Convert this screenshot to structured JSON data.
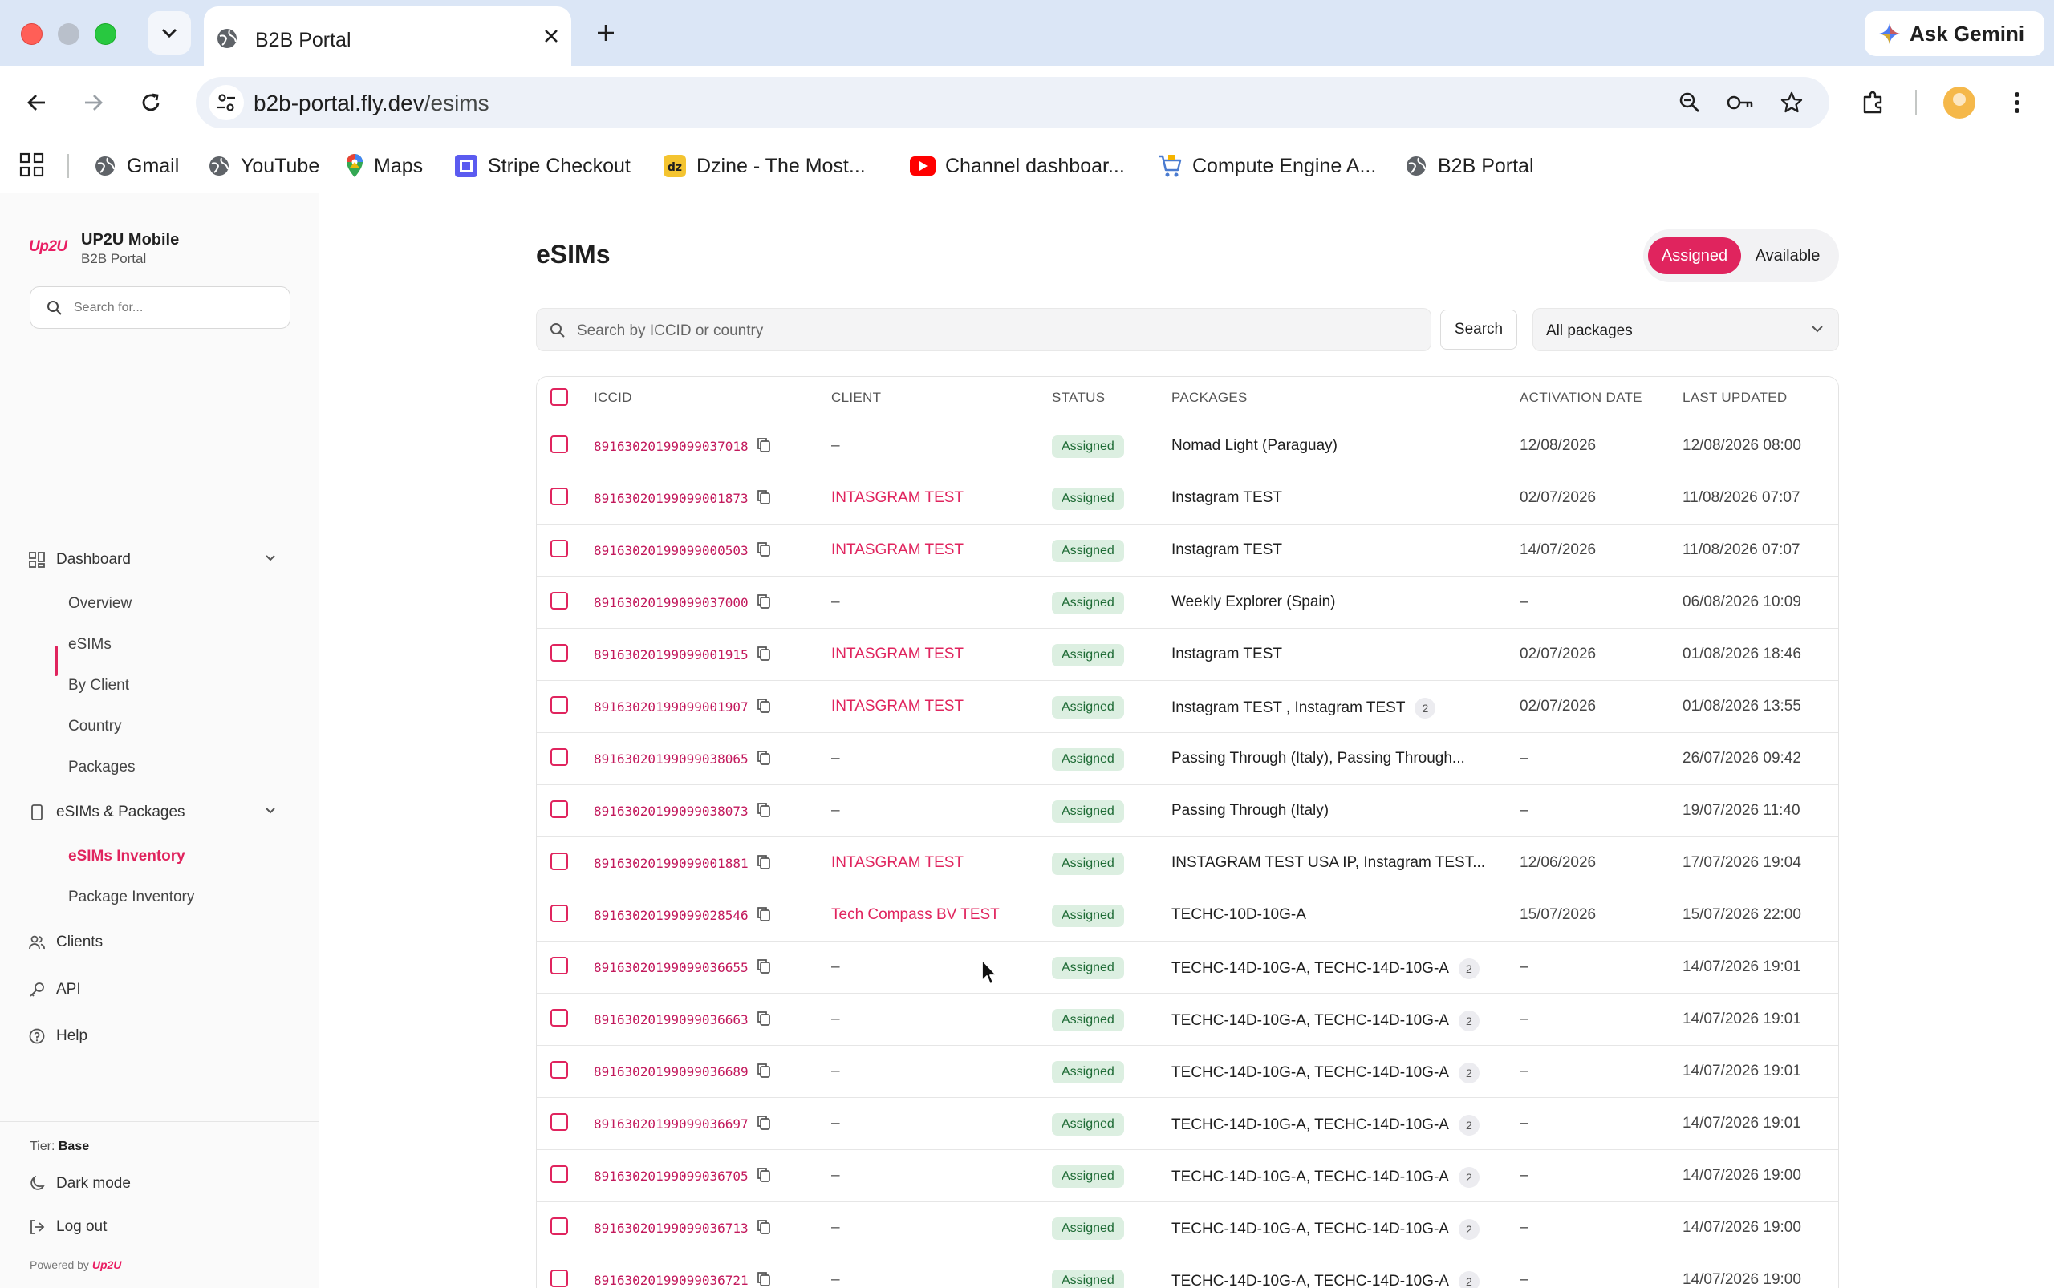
{
  "browser": {
    "tab_title": "B2B Portal",
    "url_host": "b2b-portal.fly.dev",
    "url_path": "/esims",
    "gemini_label": "Ask Gemini",
    "bookmarks": [
      {
        "label": "Gmail",
        "icon": "globe-icon"
      },
      {
        "label": "YouTube",
        "icon": "globe-icon"
      },
      {
        "label": "Maps",
        "icon": "maps-pin-icon"
      },
      {
        "label": "Stripe Checkout",
        "icon": "stripe-icon"
      },
      {
        "label": "Dzine - The Most...",
        "icon": "dzine-icon"
      },
      {
        "label": "Channel dashboar...",
        "icon": "youtube-icon"
      },
      {
        "label": "Compute Engine A...",
        "icon": "cart-icon"
      },
      {
        "label": "B2B Portal",
        "icon": "globe-icon"
      }
    ]
  },
  "sidebar": {
    "logo_text": "Up2U",
    "brand_name": "UP2U Mobile",
    "brand_sub": "B2B Portal",
    "search_placeholder": "Search for...",
    "groups": [
      {
        "label": "Dashboard",
        "icon": "grid-icon"
      },
      {
        "label": "eSIMs & Packages",
        "icon": "phone-icon"
      }
    ],
    "dashboard_items": [
      "Overview",
      "eSIMs",
      "By Client",
      "Country",
      "Packages"
    ],
    "esim_items": [
      "eSIMs Inventory",
      "Package Inventory"
    ],
    "bottom_items": [
      {
        "label": "Clients",
        "icon": "users-icon"
      },
      {
        "label": "API",
        "icon": "key-icon"
      },
      {
        "label": "Help",
        "icon": "help-icon"
      }
    ],
    "tier_label": "Tier:",
    "tier_value": "Base",
    "dark_mode": "Dark mode",
    "log_out": "Log out",
    "powered_by": "Powered by",
    "powered_brand": "Up2U"
  },
  "main": {
    "title": "eSIMs",
    "toggle": {
      "assigned": "Assigned",
      "available": "Available",
      "selected": "Assigned"
    },
    "search_placeholder": "Search by ICCID or country",
    "search_button": "Search",
    "package_filter": "All packages",
    "columns": [
      "ICCID",
      "CLIENT",
      "STATUS",
      "PACKAGES",
      "ACTIVATION DATE",
      "LAST UPDATED"
    ],
    "rows": [
      {
        "iccid": "89163020199099037018",
        "client": "–",
        "status": "Assigned",
        "packages": "Nomad Light (Paraguay)",
        "more": "",
        "activation": "12/08/2026",
        "updated": "12/08/2026 08:00"
      },
      {
        "iccid": "89163020199099001873",
        "client": "INTASGRAM TEST",
        "status": "Assigned",
        "packages": "Instagram TEST",
        "more": "",
        "activation": "02/07/2026",
        "updated": "11/08/2026 07:07"
      },
      {
        "iccid": "89163020199099000503",
        "client": "INTASGRAM TEST",
        "status": "Assigned",
        "packages": "Instagram TEST",
        "more": "",
        "activation": "14/07/2026",
        "updated": "11/08/2026 07:07"
      },
      {
        "iccid": "89163020199099037000",
        "client": "–",
        "status": "Assigned",
        "packages": "Weekly Explorer (Spain)",
        "more": "",
        "activation": "–",
        "updated": "06/08/2026 10:09"
      },
      {
        "iccid": "89163020199099001915",
        "client": "INTASGRAM TEST",
        "status": "Assigned",
        "packages": "Instagram TEST",
        "more": "",
        "activation": "02/07/2026",
        "updated": "01/08/2026 18:46"
      },
      {
        "iccid": "89163020199099001907",
        "client": "INTASGRAM TEST",
        "status": "Assigned",
        "packages": "Instagram TEST , Instagram TEST",
        "more": "2",
        "activation": "02/07/2026",
        "updated": "01/08/2026 13:55"
      },
      {
        "iccid": "89163020199099038065",
        "client": "–",
        "status": "Assigned",
        "packages": "Passing Through (Italy), Passing Through...",
        "more": "",
        "activation": "–",
        "updated": "26/07/2026 09:42"
      },
      {
        "iccid": "89163020199099038073",
        "client": "–",
        "status": "Assigned",
        "packages": "Passing Through (Italy)",
        "more": "",
        "activation": "–",
        "updated": "19/07/2026 11:40"
      },
      {
        "iccid": "89163020199099001881",
        "client": "INTASGRAM TEST",
        "status": "Assigned",
        "packages": "INSTAGRAM TEST USA IP, Instagram TEST...",
        "more": "",
        "activation": "12/06/2026",
        "updated": "17/07/2026 19:04"
      },
      {
        "iccid": "89163020199099028546",
        "client": "Tech Compass BV TEST",
        "status": "Assigned",
        "packages": "TECHC-10D-10G-A",
        "more": "",
        "activation": "15/07/2026",
        "updated": "15/07/2026 22:00"
      },
      {
        "iccid": "89163020199099036655",
        "client": "–",
        "status": "Assigned",
        "packages": "TECHC-14D-10G-A, TECHC-14D-10G-A",
        "more": "2",
        "activation": "–",
        "updated": "14/07/2026 19:01"
      },
      {
        "iccid": "89163020199099036663",
        "client": "–",
        "status": "Assigned",
        "packages": "TECHC-14D-10G-A, TECHC-14D-10G-A",
        "more": "2",
        "activation": "–",
        "updated": "14/07/2026 19:01"
      },
      {
        "iccid": "89163020199099036689",
        "client": "–",
        "status": "Assigned",
        "packages": "TECHC-14D-10G-A, TECHC-14D-10G-A",
        "more": "2",
        "activation": "–",
        "updated": "14/07/2026 19:01"
      },
      {
        "iccid": "89163020199099036697",
        "client": "–",
        "status": "Assigned",
        "packages": "TECHC-14D-10G-A, TECHC-14D-10G-A",
        "more": "2",
        "activation": "–",
        "updated": "14/07/2026 19:01"
      },
      {
        "iccid": "89163020199099036705",
        "client": "–",
        "status": "Assigned",
        "packages": "TECHC-14D-10G-A, TECHC-14D-10G-A",
        "more": "2",
        "activation": "–",
        "updated": "14/07/2026 19:00"
      },
      {
        "iccid": "89163020199099036713",
        "client": "–",
        "status": "Assigned",
        "packages": "TECHC-14D-10G-A, TECHC-14D-10G-A",
        "more": "2",
        "activation": "–",
        "updated": "14/07/2026 19:00"
      },
      {
        "iccid": "89163020199099036721",
        "client": "–",
        "status": "Assigned",
        "packages": "TECHC-14D-10G-A, TECHC-14D-10G-A",
        "more": "2",
        "activation": "–",
        "updated": "14/07/2026 19:00"
      }
    ]
  },
  "colors": {
    "accent": "#e0245e",
    "status_bg": "#dcefe1",
    "status_text": "#1e6b35"
  }
}
